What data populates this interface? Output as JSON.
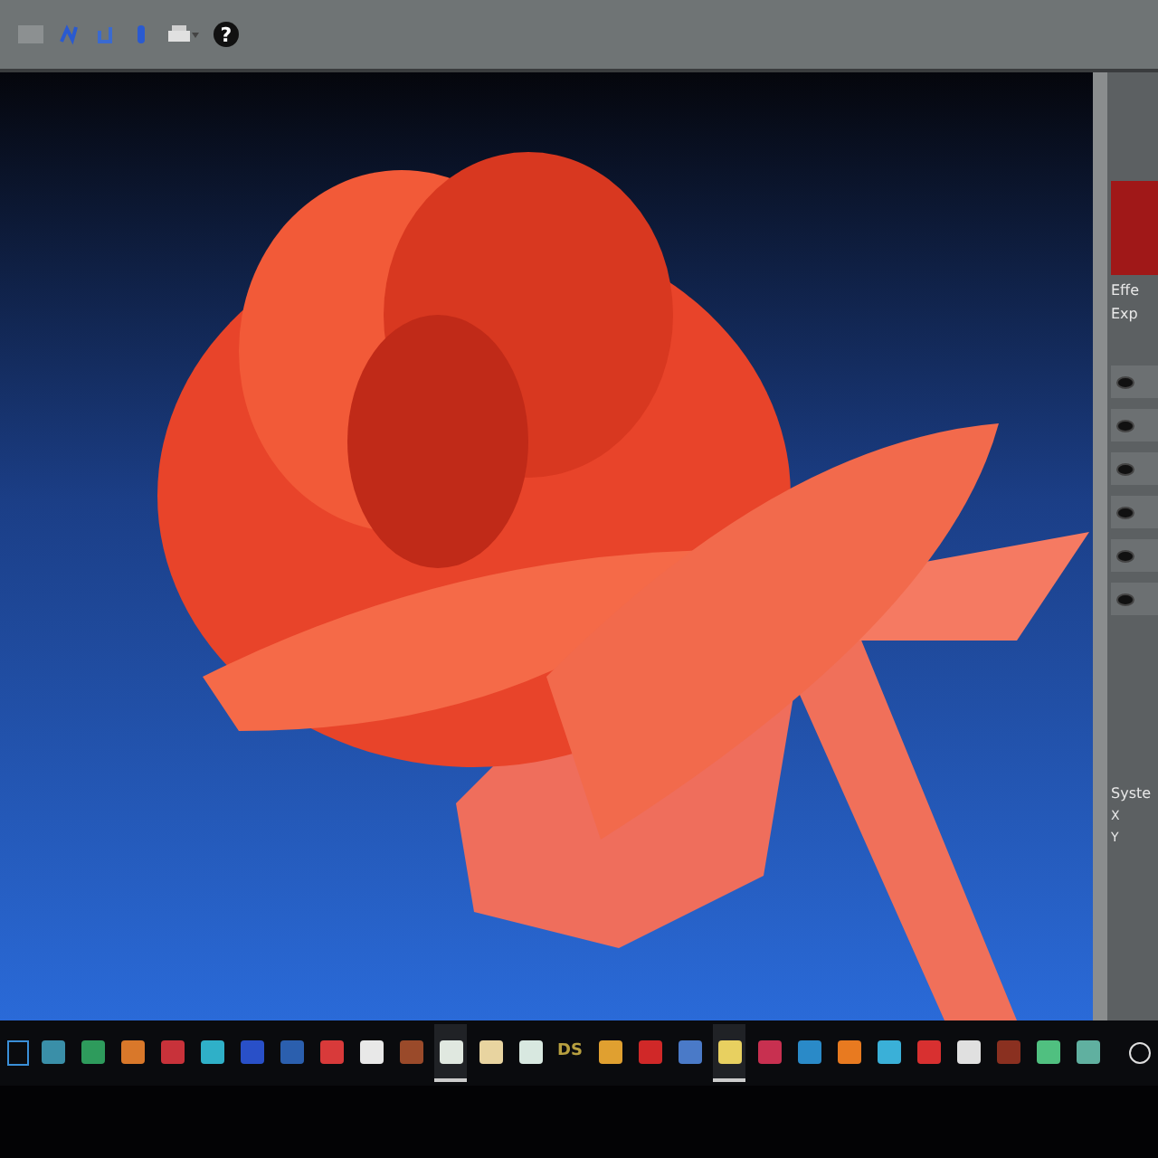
{
  "toolbar": {
    "help": "?"
  },
  "panel": {
    "effect_label": "Effe",
    "expand_label": "Exp",
    "system_label": "Syste",
    "axes": [
      "X",
      "Y"
    ],
    "layers": [
      {
        "visible": true
      },
      {
        "visible": true
      },
      {
        "visible": true
      },
      {
        "visible": true
      },
      {
        "visible": true
      },
      {
        "visible": true
      }
    ]
  },
  "taskbar": {
    "apps": [
      {
        "kind": "tile",
        "color": "#3a8fa8",
        "running": false
      },
      {
        "kind": "tile",
        "color": "#2e9b5c",
        "running": false
      },
      {
        "kind": "tile",
        "color": "#d9782a",
        "running": false
      },
      {
        "kind": "tile",
        "color": "#c8323a",
        "running": false
      },
      {
        "kind": "tile",
        "color": "#2fb0c8",
        "running": false
      },
      {
        "kind": "tile",
        "color": "#2950c8",
        "running": false
      },
      {
        "kind": "tile",
        "color": "#2b5fae",
        "running": false
      },
      {
        "kind": "tile",
        "color": "#d83a3a",
        "running": false
      },
      {
        "kind": "tile",
        "color": "#e8e8e8",
        "running": false
      },
      {
        "kind": "tile",
        "color": "#9a4a2a",
        "running": false
      },
      {
        "kind": "tile",
        "color": "#e0e8e0",
        "running": true
      },
      {
        "kind": "tile",
        "color": "#e8d4a0",
        "running": false
      },
      {
        "kind": "tile",
        "color": "#d8e8e0",
        "running": false
      },
      {
        "kind": "text",
        "label": "DS",
        "color": "#b8a040",
        "running": false
      },
      {
        "kind": "tile",
        "color": "#e0a030",
        "running": false
      },
      {
        "kind": "tile",
        "color": "#d02828",
        "running": false
      },
      {
        "kind": "tile",
        "color": "#4a7ac8",
        "running": false
      },
      {
        "kind": "tile",
        "color": "#e8d060",
        "running": true
      },
      {
        "kind": "tile",
        "color": "#c83050",
        "running": false
      },
      {
        "kind": "tile",
        "color": "#2a8ac8",
        "running": false
      },
      {
        "kind": "tile",
        "color": "#e87a20",
        "running": false
      },
      {
        "kind": "tile",
        "color": "#3ab0d8",
        "running": false
      },
      {
        "kind": "tile",
        "color": "#d83030",
        "running": false
      },
      {
        "kind": "tile",
        "color": "#e0e0e0",
        "running": false
      },
      {
        "kind": "tile",
        "color": "#8a3020",
        "running": false
      },
      {
        "kind": "tile",
        "color": "#50c080",
        "running": false
      },
      {
        "kind": "tile",
        "color": "#60b0a0",
        "running": false
      }
    ]
  }
}
